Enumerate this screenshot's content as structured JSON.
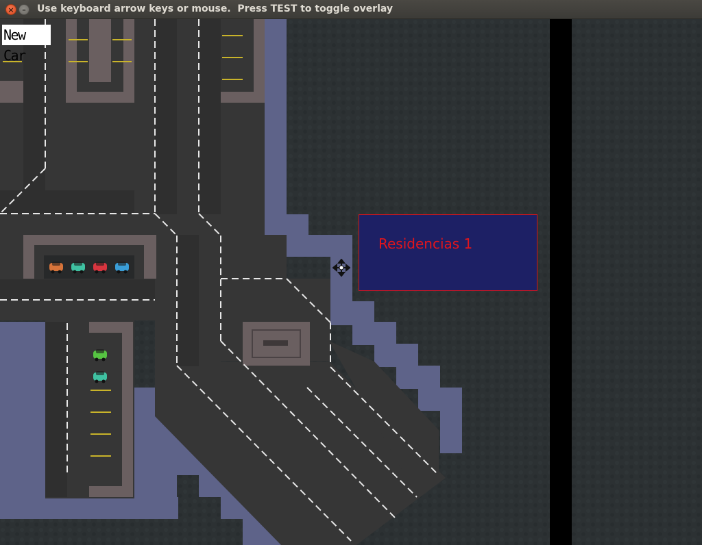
{
  "window": {
    "title": "Use keyboard arrow keys or mouse.  Press TEST to toggle overlay",
    "close_glyph": "×",
    "minimize_glyph": "–"
  },
  "hud": {
    "new_car_label": "New Car"
  },
  "zone": {
    "label": "Residencias 1",
    "fill_color": "#1d2065",
    "border_color": "#d8141c",
    "text_color": "#e3151c"
  },
  "parked_cars": [
    {
      "color": "#d8743a"
    },
    {
      "color": "#3fc2a2"
    },
    {
      "color": "#d8353f"
    },
    {
      "color": "#3a9ed8"
    },
    {
      "color": "#56c442"
    },
    {
      "color": "#3fc2a2"
    }
  ],
  "icons": {
    "cursor": "move-cursor-icon",
    "close": "close-icon",
    "minimize": "minimize-icon"
  }
}
